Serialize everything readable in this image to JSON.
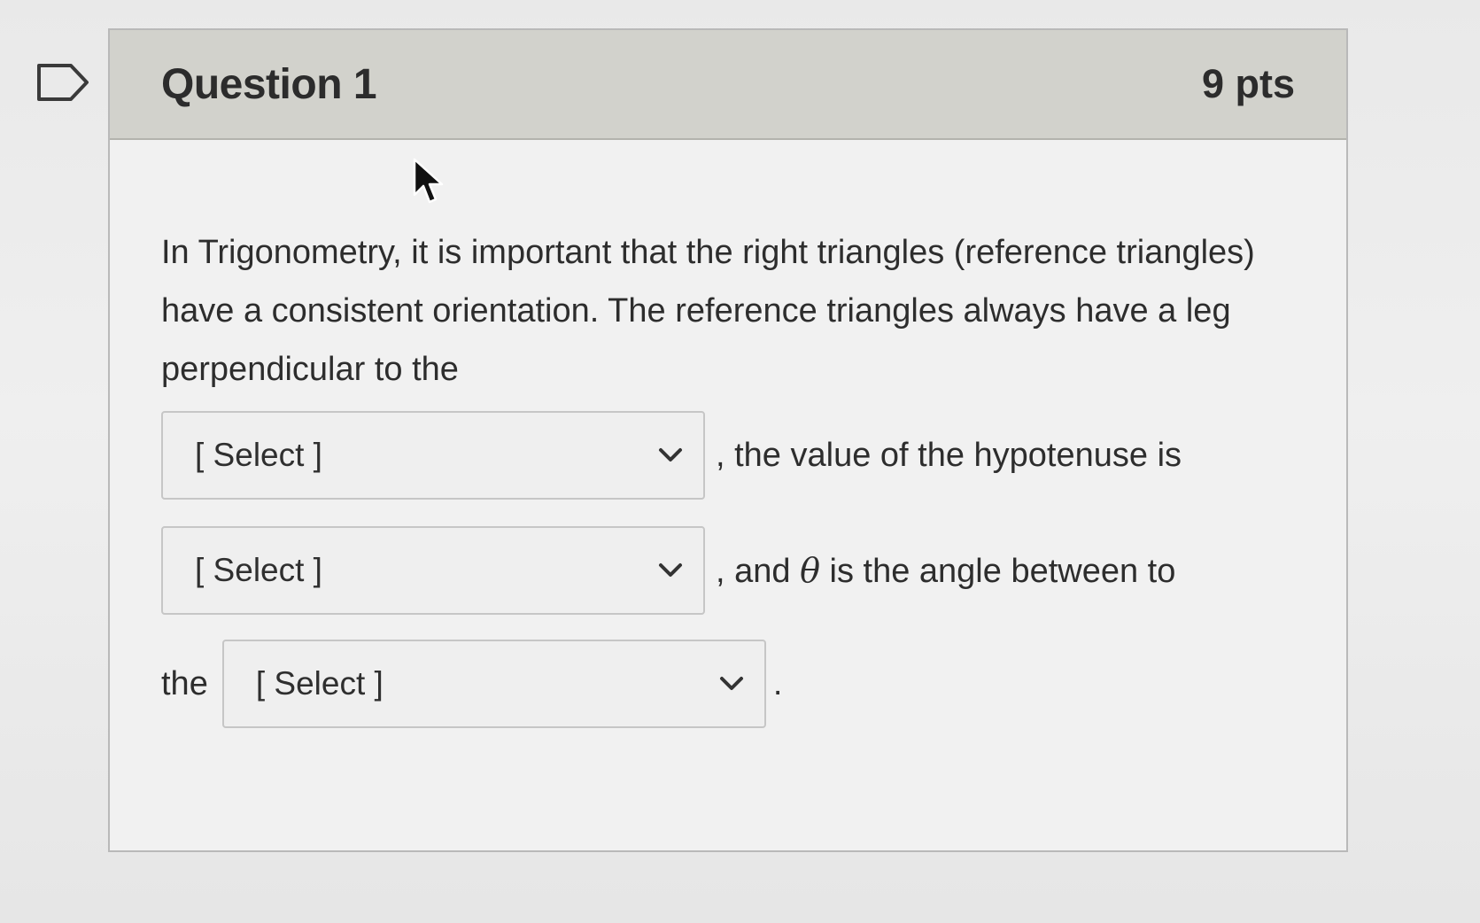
{
  "question": {
    "title": "Question 1",
    "points": "9 pts",
    "prompt_line1": "In Trigonometry, it is important that the right triangles (reference triangles) have a consistent orientation.  The reference triangles always have a leg perpendicular to the",
    "select_1": {
      "selected": "[ Select ]",
      "after_text": ", the value of the hypotenuse is"
    },
    "select_2": {
      "selected": "[ Select ]",
      "after_text_part1": ", and ",
      "theta": "θ",
      "after_text_part2": " is the angle between to"
    },
    "line3_prefix": "the",
    "select_3": {
      "selected": "[ Select ]"
    },
    "final_punctuation": "."
  },
  "icons": {
    "flag": "flag-icon",
    "chevron": "chevron-down-icon",
    "cursor": "mouse-cursor-icon"
  },
  "colors": {
    "header_bg": "#d2d2cc",
    "card_bg": "#f1f1f1",
    "text": "#2d2d2d"
  }
}
